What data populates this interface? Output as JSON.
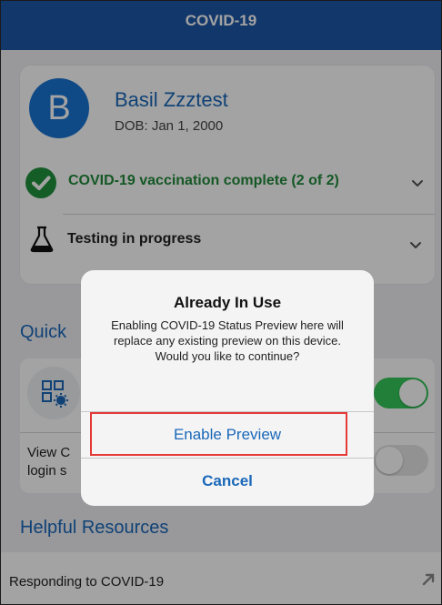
{
  "header": {
    "title": "COVID-19"
  },
  "profile": {
    "avatar_letter": "B",
    "name": "Basil Zzztest",
    "dob": "DOB: Jan 1, 2000"
  },
  "status": {
    "vaccination": "COVID-19 vaccination complete (2 of 2)",
    "testing": "Testing in progress"
  },
  "sections": {
    "quick_label": "Quick",
    "resources_label": "Helpful Resources"
  },
  "quick": {
    "view_line1": "View C",
    "view_line2": "login s"
  },
  "resources": {
    "item1": "Responding to COVID-19"
  },
  "dialog": {
    "title": "Already In Use",
    "message": "Enabling COVID-19 Status Preview here will replace any existing preview on this device. Would you like to continue?",
    "enable": "Enable Preview",
    "cancel": "Cancel"
  },
  "colors": {
    "header": "#1d57a7",
    "brand_blue": "#1a68b9",
    "success_green": "#22923e",
    "highlight_red": "#e53935"
  },
  "icons": [
    "check-circle-icon",
    "flask-icon",
    "chevron-down-icon",
    "qr-code-icon",
    "external-link-icon"
  ],
  "toggles": {
    "preview_on": true,
    "login_on": false
  }
}
